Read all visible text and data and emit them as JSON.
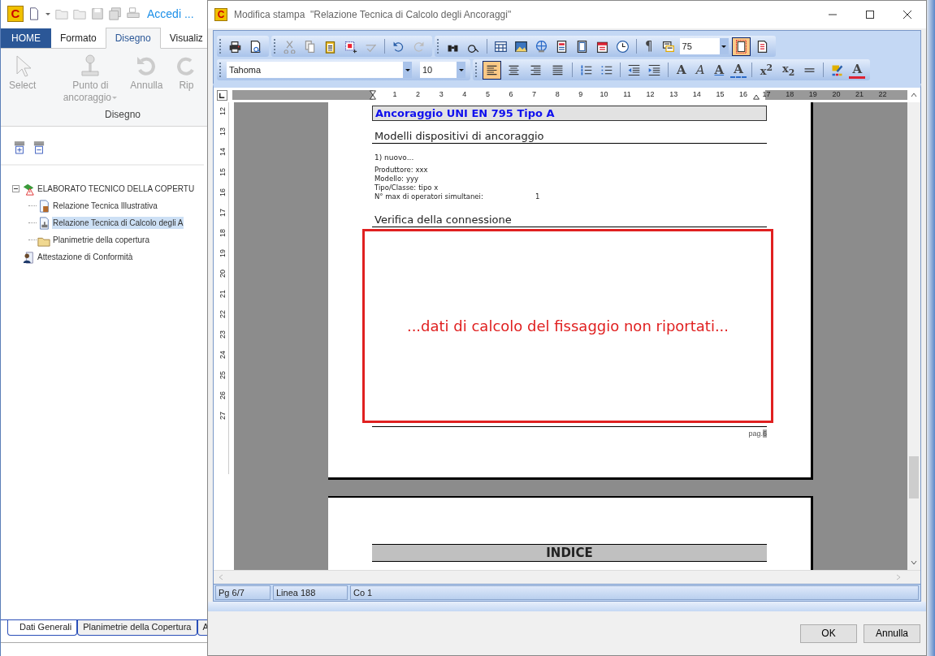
{
  "app": {
    "logo_text": "C",
    "quick_access_label": "Accedi ...",
    "ribbon_tabs": [
      {
        "label": "HOME",
        "kind": "file",
        "selected": false
      },
      {
        "label": "Formato",
        "kind": "tab",
        "selected": false
      },
      {
        "label": "Disegno",
        "kind": "tab",
        "selected": true
      },
      {
        "label": "Visualiz",
        "kind": "tab",
        "selected": false
      }
    ],
    "ribbon_buttons": [
      {
        "label": "Select",
        "kind": "select",
        "disabled": true
      },
      {
        "label": "Punto di ancoraggio",
        "kind": "anchor",
        "disabled": true
      },
      {
        "label": "Annulla",
        "kind": "undo",
        "disabled": true
      },
      {
        "label": "Rip",
        "kind": "redo",
        "disabled": true
      }
    ],
    "ribbon_group_label": "Disegno",
    "tree": [
      {
        "label": "ELABORATO TECNICO DELLA COPERTU",
        "expanded": true,
        "selected": false,
        "children": [
          {
            "label": "Relazione Tecnica Illustrativa",
            "selected": false
          },
          {
            "label": "Relazione Tecnica di Calcolo degli A",
            "selected": true
          },
          {
            "label": "Planimetrie della copertura",
            "selected": false
          }
        ]
      },
      {
        "label": "Attestazione di Conformità",
        "selected": false
      }
    ],
    "bottom_tabs": [
      {
        "label": "Dati Generali",
        "selected": true
      },
      {
        "label": "Planimetrie della Copertura",
        "selected": false
      },
      {
        "label": "A",
        "selected": false
      }
    ]
  },
  "dialog": {
    "logo_text": "C",
    "title": "Modifica stampa  \"Relazione Tecnica di Calcolo degli Ancoraggi\"",
    "pilcrow": "¶",
    "zoom": "75",
    "page_view_selected": true,
    "font": "Tahoma",
    "size": "10",
    "alignment": [
      {
        "selected": true
      },
      {
        "selected": false
      },
      {
        "selected": false
      },
      {
        "selected": false
      }
    ],
    "style_buttons": [
      {
        "label": "A",
        "kind": "bold"
      },
      {
        "label": "A",
        "kind": "italic"
      },
      {
        "label": "A",
        "kind": "underline"
      },
      {
        "label": "A",
        "kind": "strike"
      },
      {
        "label": "x$^{2}$",
        "kind": "super"
      },
      {
        "label": "x$_{2}$",
        "kind": "sub"
      }
    ],
    "font_color_label": "A",
    "h_ruler": [
      "1",
      "2",
      "3",
      "4",
      "5",
      "6",
      "7",
      "8",
      "9",
      "10",
      "11",
      "12",
      "13",
      "14",
      "15",
      "16",
      "17",
      "18",
      "19",
      "20",
      "21",
      "22"
    ],
    "v_ruler": [
      "12",
      "13",
      "14",
      "15",
      "16",
      "17",
      "18",
      "19",
      "20",
      "21",
      "22",
      "23",
      "24",
      "25",
      "26",
      "27"
    ],
    "page": {
      "heading": "Ancoraggio UNI EN 795 Tipo A",
      "section": "Modelli dispositivi di ancoraggio",
      "item": "1) nuovo...",
      "fields": [
        {
          "label": "Produttore:",
          "value": "xxx"
        },
        {
          "label": "Modello:",
          "value": "yyy"
        },
        {
          "label": "Tipo/Classe:",
          "value": "tipo x"
        }
      ],
      "operators_label": "N° max di operatori simultanei:",
      "operators_value": "1",
      "section2": "Verifica della connessione",
      "notice": "...dati di calcolo del fissaggio non riportati...",
      "footer_label": "pag.",
      "footer_number": "6"
    },
    "next_page": {
      "heading": "INDICE"
    },
    "status": [
      "Pg 6/7",
      "Linea 188",
      "Co 1"
    ],
    "buttons": [
      "OK",
      "Annulla"
    ]
  }
}
